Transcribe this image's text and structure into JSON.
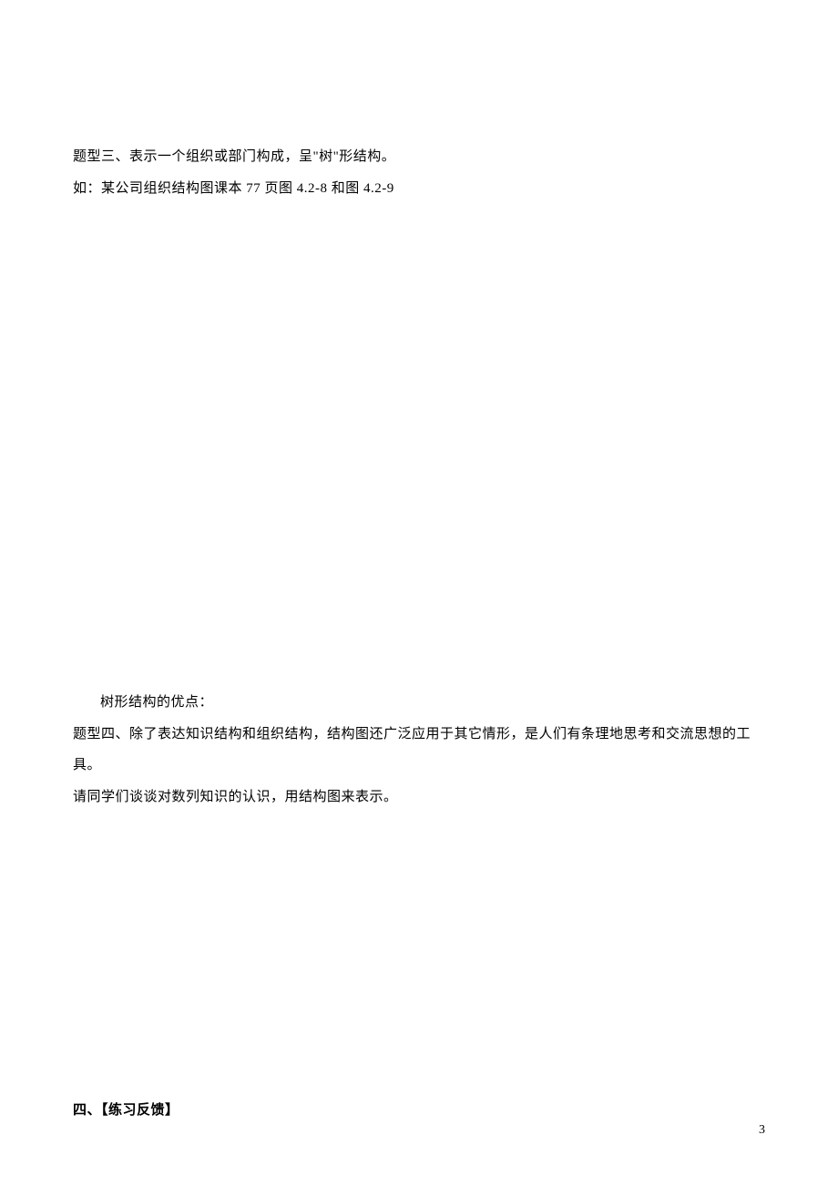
{
  "lines": {
    "l1": "题型三、表示一个组织或部门构成，呈\"树\"形结构。",
    "l2": "如：某公司组织结构图课本 77 页图 4.2-8 和图 4.2-9",
    "l3": "树形结构的优点：",
    "l4": "题型四、除了表达知识结构和组织结构，结构图还广泛应用于其它情形，是人们有条理地思考和交流思想的工具。",
    "l5": "请同学们谈谈对数列知识的认识，用结构图来表示。",
    "l6": "四、【练习反馈】"
  },
  "pageNumber": "3"
}
